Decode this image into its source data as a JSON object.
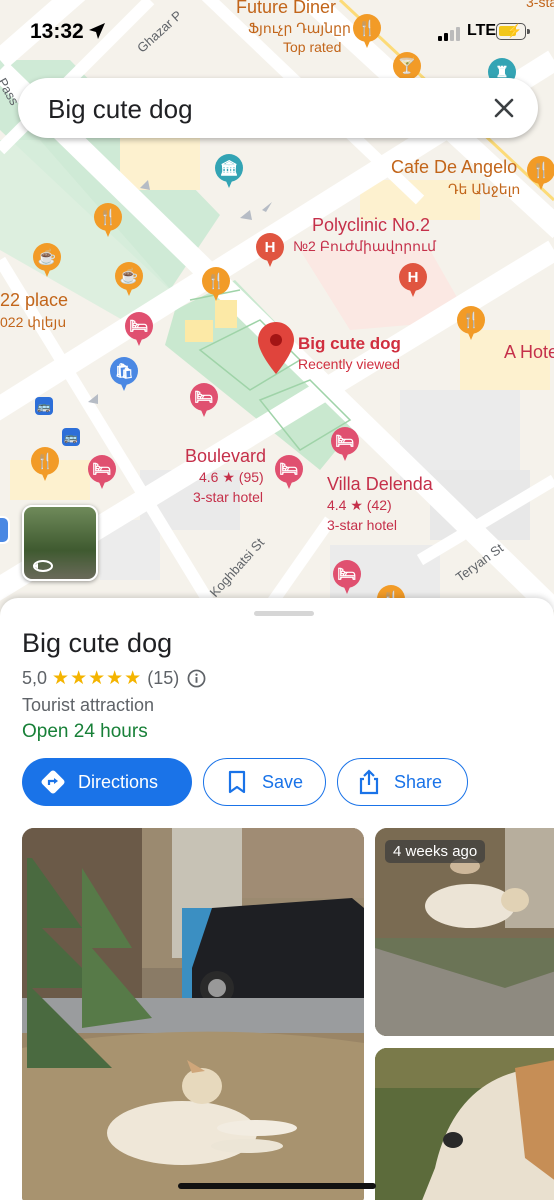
{
  "status_bar": {
    "time": "13:32",
    "network": "LTE"
  },
  "search": {
    "query": "Big cute dog"
  },
  "map": {
    "labels": {
      "future_diner": "Future Diner",
      "future_diner_sub": "Ֆյուչր Դայնըր",
      "future_diner_note": "Top rated",
      "ghazar": "Ghazar P",
      "cafe_de_angelo": "Cafe De Angelo",
      "cafe_de_angelo_sub": "Դե Անջելո",
      "polyclinic": "Polyclinic No.2",
      "polyclinic_sub": "№2 Բուժմիավորում",
      "place_22": "22 place",
      "place_22_sub": "022 փլեյս",
      "big_cute_dog": "Big cute dog",
      "recently_viewed": "Recently viewed",
      "a_hotel": "A Hote",
      "boulevard": "Boulevard",
      "boulevard_rating": "4.6 ★ (95)",
      "boulevard_class": "3-star hotel",
      "villa_delenda": "Villa Delenda",
      "villa_delenda_rating": "4.4 ★ (42)",
      "villa_delenda_class": "3-star hotel",
      "koghbatsi": "Koghbatsi St",
      "teryan": "Teryan St",
      "pass": "Pass",
      "top_right_partial": "3-star"
    }
  },
  "place": {
    "title": "Big cute dog",
    "rating": "5,0",
    "stars": "★★★★★",
    "reviews": "(15)",
    "category": "Tourist attraction",
    "hours": "Open 24 hours"
  },
  "actions": {
    "directions": "Directions",
    "save": "Save",
    "share": "Share"
  },
  "photos": {
    "badge": "4 weeks ago"
  },
  "colors": {
    "accent": "#1a73e8",
    "open": "#188038",
    "star": "#f4b400",
    "pin_red": "#e0443c"
  }
}
